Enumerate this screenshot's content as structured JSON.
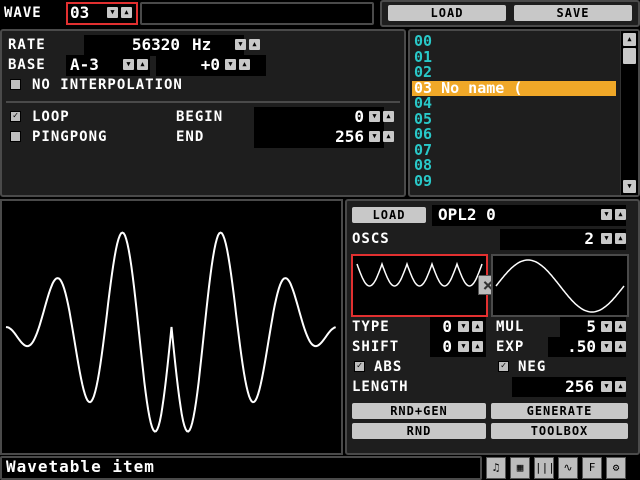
{
  "header": {
    "wave_label": "WAVE",
    "wave_value": "03",
    "load": "LOAD",
    "save": "SAVE"
  },
  "params": {
    "rate_label": "RATE",
    "rate_value": "56320",
    "rate_unit": "Hz",
    "base_label": "BASE",
    "base_note": "A-3",
    "base_offset": "+0",
    "no_interp": "NO INTERPOLATION",
    "loop": "LOOP",
    "pingpong": "PINGPONG",
    "begin_label": "BEGIN",
    "begin_value": "0",
    "end_label": "END",
    "end_value": "256"
  },
  "wavelist": {
    "items": [
      "00",
      "01",
      "02",
      "03 No name (",
      "04",
      "05",
      "06",
      "07",
      "08",
      "09"
    ],
    "selected_index": 3
  },
  "generator": {
    "load": "LOAD",
    "preset": "OPL2 0",
    "oscs_label": "OSCS",
    "oscs_value": "2",
    "remove": "×",
    "type_label": "TYPE",
    "type_value": "0",
    "mul_label": "MUL",
    "mul_value": "5",
    "shift_label": "SHIFT",
    "shift_value": "0",
    "exp_label": "EXP",
    "exp_value": ".50",
    "abs": "ABS",
    "neg": "NEG",
    "length_label": "LENGTH",
    "length_value": "256",
    "rnd_gen": "RND+GEN",
    "generate": "GENERATE",
    "rnd": "RND",
    "toolbox": "TOOLBOX"
  },
  "status": {
    "text": "Wavetable item"
  },
  "checks": {
    "no_interp": false,
    "loop": true,
    "pingpong": false,
    "abs": true,
    "neg": true
  },
  "colors": {
    "list_text": "#29c8c8",
    "selection": "#f0a828",
    "highlight": "#e23030",
    "wave": "#ffffff"
  },
  "icons": [
    "up-arrow-icon",
    "down-arrow-icon",
    "scrollbar-up-icon",
    "scrollbar-down-icon",
    "music-note-icon",
    "grid-icon",
    "bars-icon",
    "waveform-icon",
    "fx-icon",
    "wrench-icon"
  ]
}
